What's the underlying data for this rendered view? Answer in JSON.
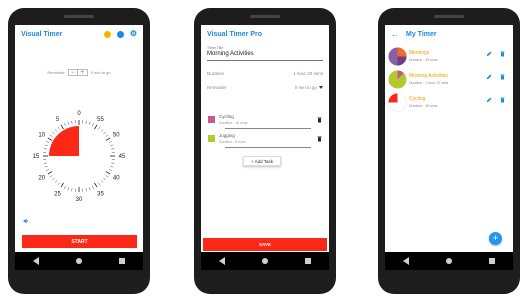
{
  "screen1": {
    "title": "Visual Timer",
    "reminder_label": "Reminder",
    "reminder_minus": "−",
    "reminder_plus": "+",
    "reminder_value": "0 min to go",
    "dial_minutes": [
      "0",
      "5",
      "10",
      "15",
      "20",
      "25",
      "30",
      "35",
      "40",
      "45",
      "50",
      "55"
    ],
    "remaining_minutes": 15,
    "start_label": "START",
    "accent_color": "#fb2818"
  },
  "screen2": {
    "title": "Visual Timer Pro",
    "timer_title_label": "Timer Title",
    "timer_title_value": "Morning Activities",
    "duration_label": "Duration",
    "duration_value": "1 hour 20 mins",
    "reminder_label": "Reminder",
    "reminder_value": "0 min to go",
    "activities": [
      {
        "name": "Cycling",
        "duration": "Duration : 15 mins",
        "color": "#c9578a"
      },
      {
        "name": "Jogging",
        "duration": "Duration : 5 mins",
        "color": "#b5c830"
      }
    ],
    "add_task_label": "+ Add Task",
    "save_label": "SAVE"
  },
  "screen3": {
    "title": "My Timer",
    "timers": [
      {
        "name": "Meetings",
        "duration": "Duration : 45 mins"
      },
      {
        "name": "Morning Activities",
        "duration": "Duration : 1 hour 20 mins"
      },
      {
        "name": "Cycling",
        "duration": "Duration : 15 mins"
      }
    ],
    "fab_label": "+",
    "brand_color": "#1e88e5"
  }
}
